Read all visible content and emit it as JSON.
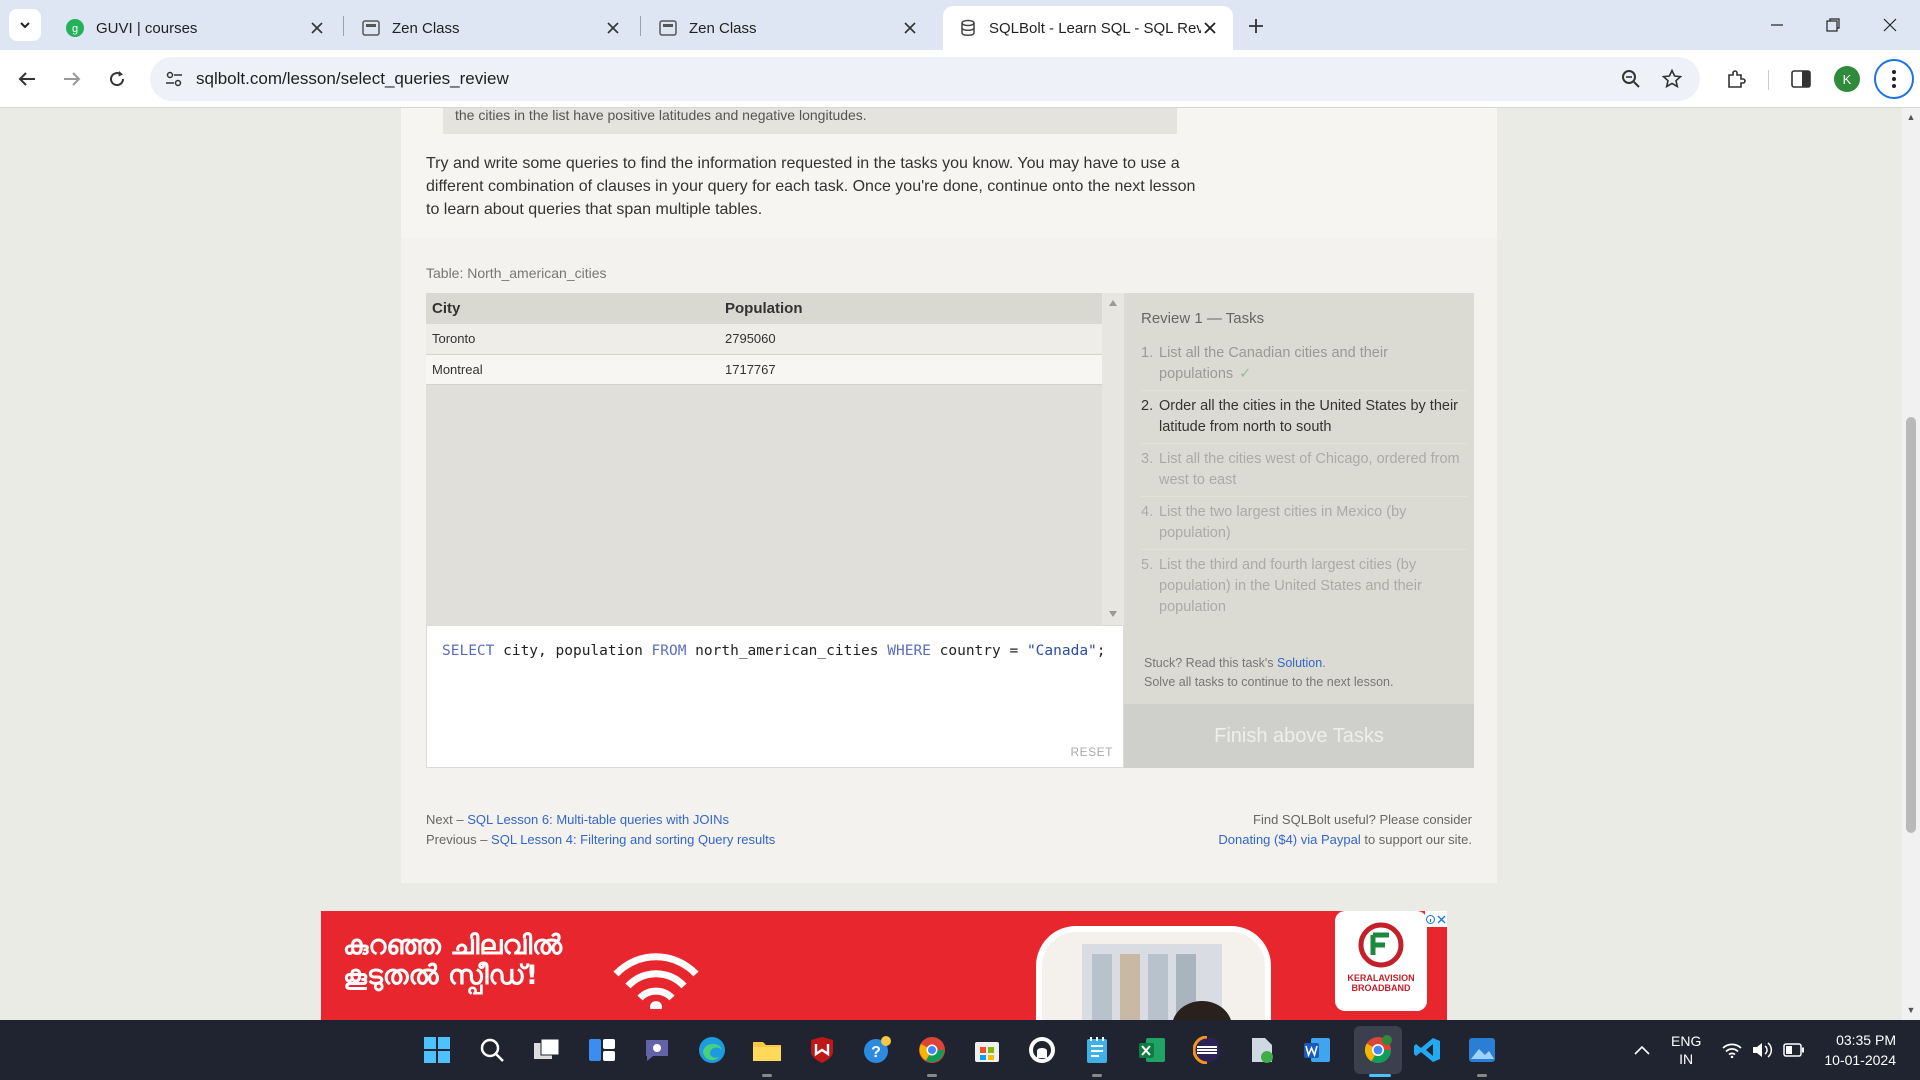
{
  "browser": {
    "tabs": [
      {
        "title": "GUVI | courses",
        "active": false
      },
      {
        "title": "Zen Class",
        "active": false
      },
      {
        "title": "Zen Class",
        "active": false
      },
      {
        "title": "SQLBolt - Learn SQL - SQL Revi",
        "active": true
      }
    ],
    "url": "sqlbolt.com/lesson/select_queries_review",
    "profile_initial": "K"
  },
  "page": {
    "note_text": "the cities in the list have positive latitudes and negative longitudes.",
    "intro": "Try and write some queries to find the information requested in the tasks you know. You may have to use a different combination of clauses in your query for each task. Once you're done, continue onto the next lesson to learn about queries that span multiple tables.",
    "table_label": "Table: North_american_cities",
    "result": {
      "columns": [
        "City",
        "Population"
      ],
      "rows": [
        [
          "Toronto",
          "2795060"
        ],
        [
          "Montreal",
          "1717767"
        ]
      ]
    },
    "query": {
      "kw_select": "SELECT",
      "cols": " city, population ",
      "kw_from": "FROM",
      "table": " north_american_cities ",
      "kw_where": "WHERE",
      "cond": " country = ",
      "value": "\"Canada\"",
      "end": ";"
    },
    "reset_label": "RESET",
    "tasks_title": "Review 1 — Tasks",
    "tasks": [
      {
        "num": "1.",
        "text": "List all the Canadian cities and their populations",
        "state": "done"
      },
      {
        "num": "2.",
        "text": "Order all the cities in the United States by their latitude from north to south",
        "state": "current"
      },
      {
        "num": "3.",
        "text": "List all the cities west of Chicago, ordered from west to east",
        "state": "future"
      },
      {
        "num": "4.",
        "text": "List the two largest cities in Mexico (by population)",
        "state": "future"
      },
      {
        "num": "5.",
        "text": "List the third and fourth largest cities (by population) in the United States and their population",
        "state": "future"
      }
    ],
    "check_mark": "✓",
    "stuck_prefix": "Stuck? Read this task's ",
    "stuck_link": "Solution",
    "stuck_suffix": ".",
    "stuck_line2": "Solve all tasks to continue to the next lesson.",
    "finish_label": "Finish above Tasks",
    "footer": {
      "next_prefix": "Next – ",
      "next_link": "SQL Lesson 6: Multi-table queries with JOINs",
      "prev_prefix": "Previous – ",
      "prev_link": "SQL Lesson 4: Filtering and sorting Query results",
      "support_line1": "Find SQLBolt useful? Please consider",
      "donate_link": "Donating ($4) via Paypal",
      "support_suffix": " to support our site."
    }
  },
  "ad": {
    "line1": "കുറഞ്ഞ ചിലവിൽ",
    "line2": "കൂടുതൽ സ്പീഡ്!",
    "logo_line1": "KERALAVISION",
    "logo_line2": "BROADBAND",
    "brand_color": "#e8262d"
  },
  "taskbar": {
    "lang_line1": "ENG",
    "lang_line2": "IN",
    "time": "03:35 PM",
    "date": "10-01-2024"
  }
}
